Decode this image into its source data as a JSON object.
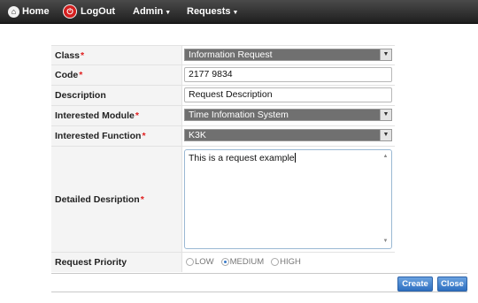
{
  "nav": {
    "home_label": "Home",
    "logout_label": "LogOut",
    "admin_label": "Admin",
    "requests_label": "Requests"
  },
  "form": {
    "class": {
      "label": "Class",
      "value": "Information Request"
    },
    "code": {
      "label": "Code",
      "value": "2177 9834"
    },
    "description": {
      "label": "Description",
      "value": "Request Description"
    },
    "module": {
      "label": "Interested Module",
      "value": "Time Infomation System"
    },
    "function": {
      "label": "Interested Function",
      "value": "K3K"
    },
    "detailed": {
      "label": "Detailed Desription",
      "value": "This is a request example"
    },
    "priority": {
      "label": "Request Priority",
      "options": [
        "LOW",
        "MEDIUM",
        "HIGH"
      ],
      "selected": "MEDIUM"
    },
    "required_mark": "*"
  },
  "buttons": {
    "create_label": "Create",
    "close_label": "Close"
  },
  "colors": {
    "topbar": "#2b2b2b",
    "select_bg": "#707070",
    "button_blue": "#3a7bc8",
    "required": "#e02020"
  }
}
